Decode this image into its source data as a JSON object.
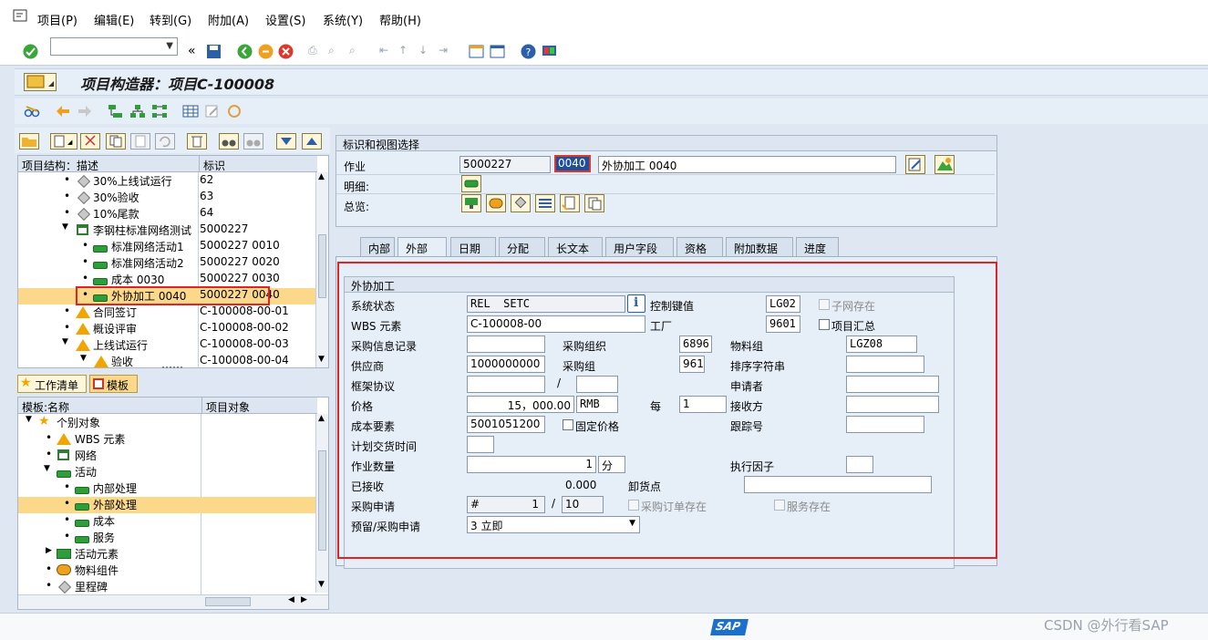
{
  "menu": [
    "项目(P)",
    "编辑(E)",
    "转到(G)",
    "附加(A)",
    "设置(S)",
    "系统(Y)",
    "帮助(H)"
  ],
  "title": "项目构造器：项目C-100008",
  "tree": {
    "header_desc": "项目结构：描述",
    "header_id": "标识",
    "rows": [
      {
        "label": "30%上线试运行",
        "id": "62",
        "icon": "diamond-icon"
      },
      {
        "label": "30%验收",
        "id": "63",
        "icon": "diamond-icon"
      },
      {
        "label": "10%尾款",
        "id": "64",
        "icon": "diamond-icon"
      },
      {
        "label": "李钢柱标准网络测试",
        "id": "5000227",
        "icon": "network-icon"
      },
      {
        "label": "标准网络活动1",
        "id": "5000227 0010",
        "icon": "activity-icon"
      },
      {
        "label": "标准网络活动2",
        "id": "5000227 0020",
        "icon": "activity-icon"
      },
      {
        "label": "成本 0030",
        "id": "5000227 0030",
        "icon": "activity-icon"
      },
      {
        "label": "外协加工 0040",
        "id": "5000227 0040",
        "icon": "activity-icon"
      },
      {
        "label": "合同签订",
        "id": "C-100008-00-01",
        "icon": "wbs-icon"
      },
      {
        "label": "概设评审",
        "id": "C-100008-00-02",
        "icon": "wbs-icon"
      },
      {
        "label": "上线试运行",
        "id": "C-100008-00-03",
        "icon": "wbs-icon"
      },
      {
        "label": "验收",
        "id": "C-100008-00-04",
        "icon": "wbs-icon"
      }
    ]
  },
  "worklist": {
    "tab_worklist": "工作清单",
    "tab_template": "模板"
  },
  "template_tree": {
    "header_name": "模板:名称",
    "header_obj": "项目对象",
    "rows": [
      {
        "label": "个别对象",
        "icon": "star-icon"
      },
      {
        "label": "WBS 元素",
        "icon": "wbs-icon"
      },
      {
        "label": "网络",
        "icon": "network-icon"
      },
      {
        "label": "活动",
        "icon": "activity-icon"
      },
      {
        "label": "内部处理",
        "icon": "activity-icon"
      },
      {
        "label": "外部处理",
        "icon": "activity-icon"
      },
      {
        "label": "成本",
        "icon": "activity-icon"
      },
      {
        "label": "服务",
        "icon": "activity-icon"
      },
      {
        "label": "活动元素",
        "icon": "activity-element-icon"
      },
      {
        "label": "物料组件",
        "icon": "material-icon"
      },
      {
        "label": "里程碑",
        "icon": "diamond-icon"
      }
    ]
  },
  "ident": {
    "group_title": "标识和视图选择",
    "activity_label": "作业",
    "network": "5000227",
    "activity": "0040",
    "description": "外协加工 0040",
    "detail_label": "明细:",
    "overview_label": "总览:"
  },
  "tabs": [
    "内部",
    "外部",
    "日期",
    "分配",
    "长文本",
    "用户字段",
    "资格",
    "附加数据",
    "进度"
  ],
  "ext": {
    "group_title": "外协加工",
    "sys_status_label": "系统状态",
    "sys_status": "REL  SETC",
    "control_key_label": "控制键值",
    "control_key": "LG02",
    "subnet_label": "子网存在",
    "wbs_label": "WBS 元素",
    "wbs": "C-100008-00",
    "plant_label": "工厂",
    "plant": "9601",
    "proj_summary_label": "项目汇总",
    "info_rec_label": "采购信息记录",
    "info_rec": "",
    "purch_org_label": "采购组织",
    "purch_org": "6896",
    "mat_group_label": "物料组",
    "mat_group": "LGZ08",
    "vendor_label": "供应商",
    "vendor": "1000000000",
    "purch_group_label": "采购组",
    "purch_group": "961",
    "sort_label": "排序字符串",
    "outline_label": "框架协议",
    "slash": "/",
    "requester_label": "申请者",
    "price_label": "价格",
    "price": "15，000.00",
    "currency": "RMB",
    "per_label": "每",
    "per": "1",
    "recipient_label": "接收方",
    "cost_elem_label": "成本要素",
    "cost_elem": "5001051200",
    "fixed_price_label": "固定价格",
    "tracking_label": "跟踪号",
    "plan_deliv_label": "计划交货时间",
    "qty_label": "作业数量",
    "qty": "1",
    "unit": "分",
    "exec_factor_label": "执行因子",
    "received_label": "已接收",
    "received": "0.000",
    "unload_label": "卸货点",
    "preq_label": "采购申请",
    "preq_no": "#",
    "preq_item1": "1",
    "preq_item2": "10",
    "po_exists_label": "采购订单存在",
    "service_exists_label": "服务存在",
    "reserv_label": "预留/采购申请",
    "reserv": "3 立即"
  },
  "watermark": "CSDN @外行看SAP",
  "sap_logo": "SAP"
}
